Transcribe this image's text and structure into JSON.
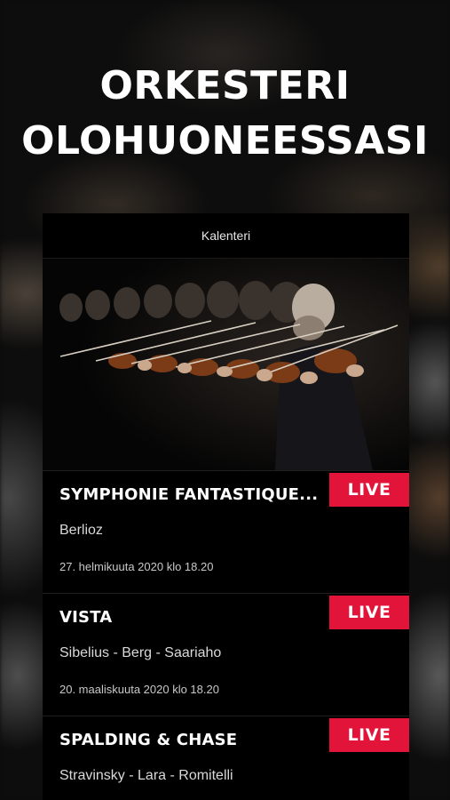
{
  "headline": {
    "line1": "ORKESTERI",
    "line2": "OLOHUONEESSASI"
  },
  "panel": {
    "header_label": "Kalenteri"
  },
  "hero": {
    "icon": "orchestra-photo"
  },
  "events": [
    {
      "title": "SYMPHONIE FANTASTIQUE...",
      "composers": "Berlioz",
      "date": "27. helmikuuta 2020 klo 18.20",
      "badge": "LIVE"
    },
    {
      "title": "VISTA",
      "composers": "Sibelius - Berg - Saariaho",
      "date": "20. maaliskuuta 2020 klo 18.20",
      "badge": "LIVE"
    },
    {
      "title": "SPALDING & CHASE",
      "composers": "Stravinsky - Lara - Romitelli",
      "date": "",
      "badge": "LIVE"
    }
  ],
  "colors": {
    "accent": "#e3143a",
    "background": "#000000",
    "text": "#ffffff"
  }
}
